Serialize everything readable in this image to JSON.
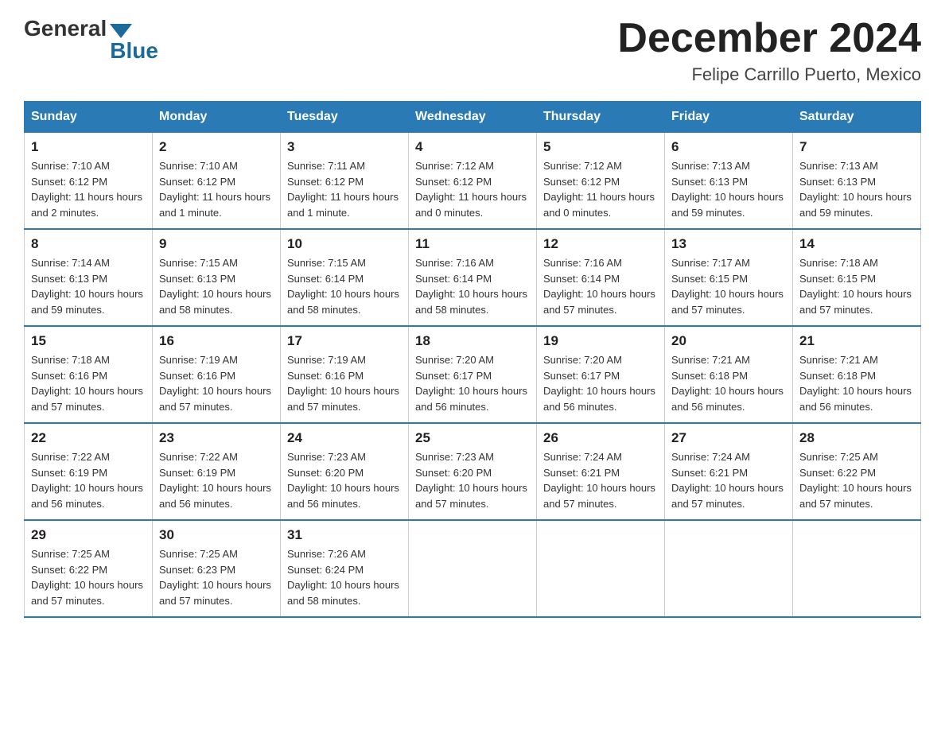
{
  "header": {
    "logo": {
      "general": "General",
      "blue": "Blue"
    },
    "title": "December 2024",
    "location": "Felipe Carrillo Puerto, Mexico"
  },
  "weekdays": [
    "Sunday",
    "Monday",
    "Tuesday",
    "Wednesday",
    "Thursday",
    "Friday",
    "Saturday"
  ],
  "weeks": [
    [
      {
        "day": "1",
        "sunrise": "7:10 AM",
        "sunset": "6:12 PM",
        "daylight": "11 hours and 2 minutes."
      },
      {
        "day": "2",
        "sunrise": "7:10 AM",
        "sunset": "6:12 PM",
        "daylight": "11 hours and 1 minute."
      },
      {
        "day": "3",
        "sunrise": "7:11 AM",
        "sunset": "6:12 PM",
        "daylight": "11 hours and 1 minute."
      },
      {
        "day": "4",
        "sunrise": "7:12 AM",
        "sunset": "6:12 PM",
        "daylight": "11 hours and 0 minutes."
      },
      {
        "day": "5",
        "sunrise": "7:12 AM",
        "sunset": "6:12 PM",
        "daylight": "11 hours and 0 minutes."
      },
      {
        "day": "6",
        "sunrise": "7:13 AM",
        "sunset": "6:13 PM",
        "daylight": "10 hours and 59 minutes."
      },
      {
        "day": "7",
        "sunrise": "7:13 AM",
        "sunset": "6:13 PM",
        "daylight": "10 hours and 59 minutes."
      }
    ],
    [
      {
        "day": "8",
        "sunrise": "7:14 AM",
        "sunset": "6:13 PM",
        "daylight": "10 hours and 59 minutes."
      },
      {
        "day": "9",
        "sunrise": "7:15 AM",
        "sunset": "6:13 PM",
        "daylight": "10 hours and 58 minutes."
      },
      {
        "day": "10",
        "sunrise": "7:15 AM",
        "sunset": "6:14 PM",
        "daylight": "10 hours and 58 minutes."
      },
      {
        "day": "11",
        "sunrise": "7:16 AM",
        "sunset": "6:14 PM",
        "daylight": "10 hours and 58 minutes."
      },
      {
        "day": "12",
        "sunrise": "7:16 AM",
        "sunset": "6:14 PM",
        "daylight": "10 hours and 57 minutes."
      },
      {
        "day": "13",
        "sunrise": "7:17 AM",
        "sunset": "6:15 PM",
        "daylight": "10 hours and 57 minutes."
      },
      {
        "day": "14",
        "sunrise": "7:18 AM",
        "sunset": "6:15 PM",
        "daylight": "10 hours and 57 minutes."
      }
    ],
    [
      {
        "day": "15",
        "sunrise": "7:18 AM",
        "sunset": "6:16 PM",
        "daylight": "10 hours and 57 minutes."
      },
      {
        "day": "16",
        "sunrise": "7:19 AM",
        "sunset": "6:16 PM",
        "daylight": "10 hours and 57 minutes."
      },
      {
        "day": "17",
        "sunrise": "7:19 AM",
        "sunset": "6:16 PM",
        "daylight": "10 hours and 57 minutes."
      },
      {
        "day": "18",
        "sunrise": "7:20 AM",
        "sunset": "6:17 PM",
        "daylight": "10 hours and 56 minutes."
      },
      {
        "day": "19",
        "sunrise": "7:20 AM",
        "sunset": "6:17 PM",
        "daylight": "10 hours and 56 minutes."
      },
      {
        "day": "20",
        "sunrise": "7:21 AM",
        "sunset": "6:18 PM",
        "daylight": "10 hours and 56 minutes."
      },
      {
        "day": "21",
        "sunrise": "7:21 AM",
        "sunset": "6:18 PM",
        "daylight": "10 hours and 56 minutes."
      }
    ],
    [
      {
        "day": "22",
        "sunrise": "7:22 AM",
        "sunset": "6:19 PM",
        "daylight": "10 hours and 56 minutes."
      },
      {
        "day": "23",
        "sunrise": "7:22 AM",
        "sunset": "6:19 PM",
        "daylight": "10 hours and 56 minutes."
      },
      {
        "day": "24",
        "sunrise": "7:23 AM",
        "sunset": "6:20 PM",
        "daylight": "10 hours and 56 minutes."
      },
      {
        "day": "25",
        "sunrise": "7:23 AM",
        "sunset": "6:20 PM",
        "daylight": "10 hours and 57 minutes."
      },
      {
        "day": "26",
        "sunrise": "7:24 AM",
        "sunset": "6:21 PM",
        "daylight": "10 hours and 57 minutes."
      },
      {
        "day": "27",
        "sunrise": "7:24 AM",
        "sunset": "6:21 PM",
        "daylight": "10 hours and 57 minutes."
      },
      {
        "day": "28",
        "sunrise": "7:25 AM",
        "sunset": "6:22 PM",
        "daylight": "10 hours and 57 minutes."
      }
    ],
    [
      {
        "day": "29",
        "sunrise": "7:25 AM",
        "sunset": "6:22 PM",
        "daylight": "10 hours and 57 minutes."
      },
      {
        "day": "30",
        "sunrise": "7:25 AM",
        "sunset": "6:23 PM",
        "daylight": "10 hours and 57 minutes."
      },
      {
        "day": "31",
        "sunrise": "7:26 AM",
        "sunset": "6:24 PM",
        "daylight": "10 hours and 58 minutes."
      },
      null,
      null,
      null,
      null
    ]
  ],
  "labels": {
    "sunrise": "Sunrise:",
    "sunset": "Sunset:",
    "daylight": "Daylight:"
  }
}
